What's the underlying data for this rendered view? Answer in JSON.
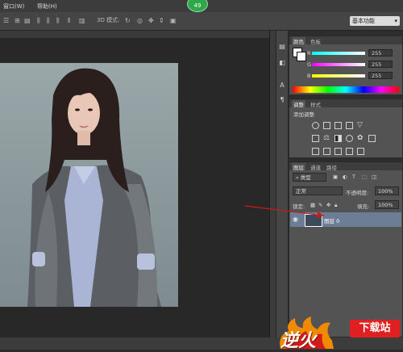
{
  "menu": {
    "items": [
      "窗口(W)",
      "帮助(H)"
    ],
    "badge": "49"
  },
  "optbar": {
    "mode_label": "3D 模式:",
    "workspace": "基本功能"
  },
  "color_panel": {
    "tabs": [
      "颜色",
      "色板"
    ],
    "channels": [
      {
        "label": "R",
        "value": "255"
      },
      {
        "label": "G",
        "value": "255"
      },
      {
        "label": "B",
        "value": "255"
      }
    ]
  },
  "adjust_panel": {
    "tabs": [
      "调整",
      "样式"
    ],
    "heading": "添加调整"
  },
  "layers_panel": {
    "tabs": [
      "图层",
      "通道",
      "路径"
    ],
    "filter_kind": "类型",
    "blend_mode": "正常",
    "opacity_label": "不透明度:",
    "opacity": "100%",
    "lock_label": "锁定:",
    "fill_label": "填充:",
    "fill": "100%",
    "layer_name": "图层 0"
  },
  "watermark": {
    "brand": "逆火",
    "site": "下载站"
  },
  "colors": {
    "accent_layer": "#6b7e96",
    "badge": "#2fa84a",
    "watermark_red": "#d21a1a",
    "watermark_orange": "#f08a00"
  }
}
